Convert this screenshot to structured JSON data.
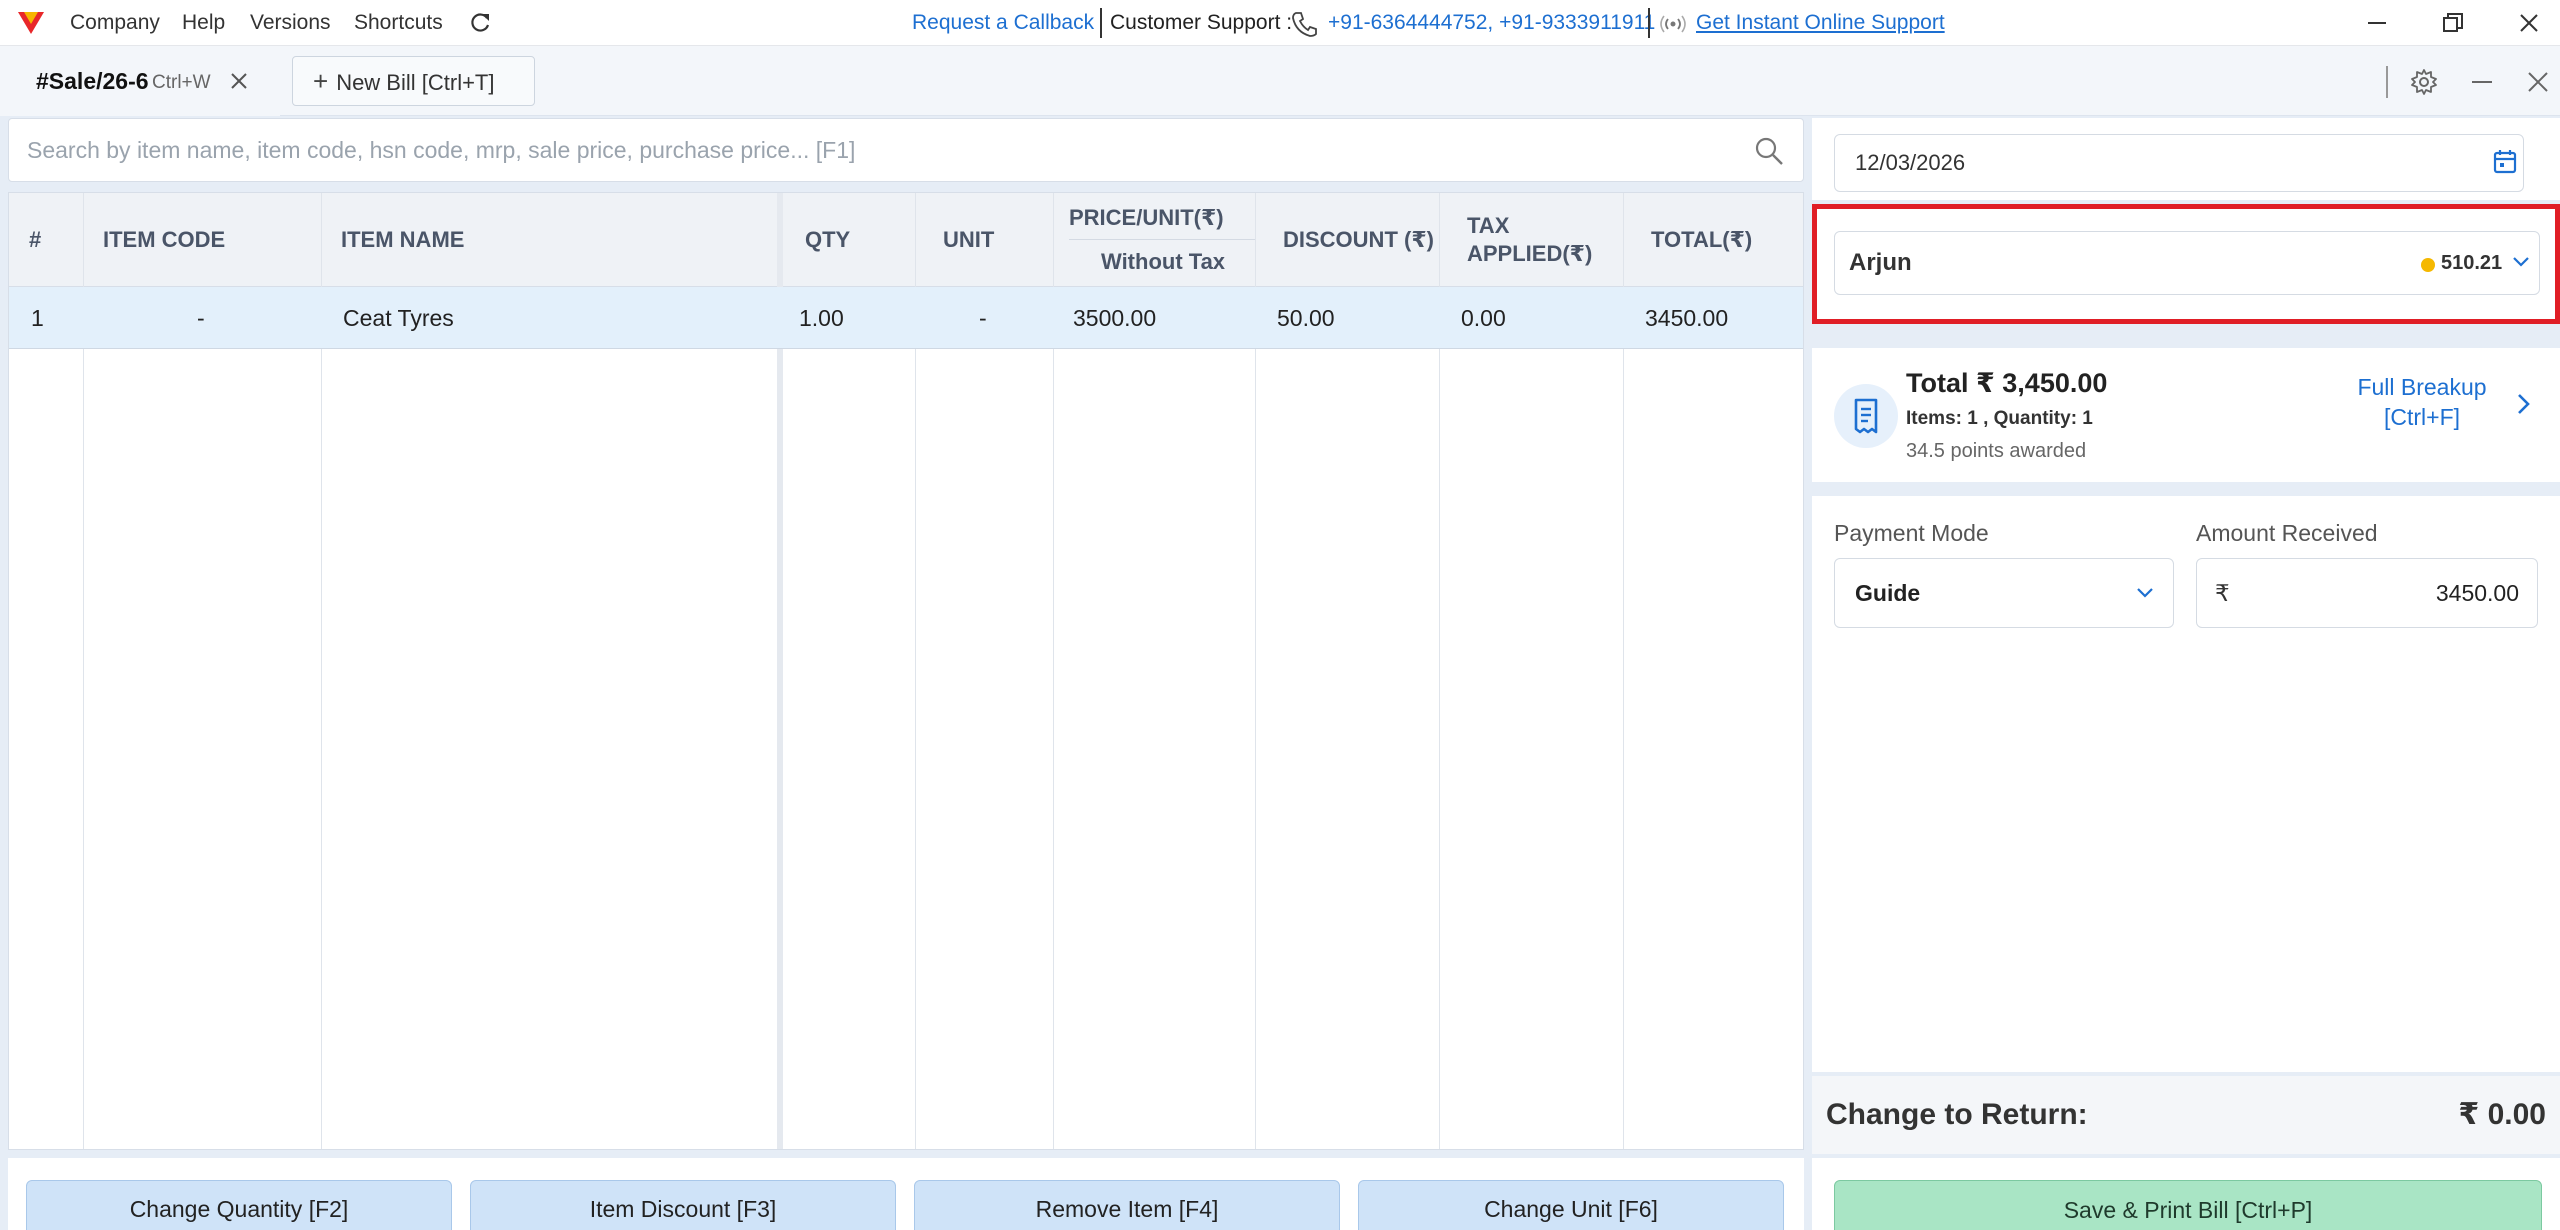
{
  "titlebar": {
    "menu": [
      "Company",
      "Help",
      "Versions",
      "Shortcuts"
    ],
    "request_callback": "Request a Callback",
    "support_label": "Customer Support :",
    "support_phones": "+91-6364444752, +91-9333911911",
    "online_support": "Get Instant Online Support"
  },
  "tabs": {
    "active_title": "#Sale/26-6",
    "active_shortcut": "Ctrl+W",
    "new_bill": "New Bill [Ctrl+T]"
  },
  "search": {
    "placeholder": "Search by item name, item code, hsn code, mrp, sale price, purchase price... [F1]"
  },
  "table": {
    "headers": {
      "index": "#",
      "item_code": "ITEM CODE",
      "item_name": "ITEM NAME",
      "qty": "QTY",
      "unit": "UNIT",
      "price": "PRICE/UNIT(₹)",
      "price_sub": "Without Tax",
      "discount": "DISCOUNT (₹)",
      "tax": "TAX APPLIED(₹)",
      "total": "TOTAL(₹)"
    },
    "rows": [
      {
        "index": "1",
        "item_code": "-",
        "item_name": "Ceat Tyres",
        "qty": "1.00",
        "unit": "-",
        "price": "3500.00",
        "discount": "50.00",
        "tax": "0.00",
        "total": "3450.00"
      }
    ]
  },
  "actions": {
    "change_qty": "Change Quantity [F2]",
    "item_discount": "Item Discount [F3]",
    "remove_item": "Remove Item [F4]",
    "change_unit": "Change Unit [F6]"
  },
  "right": {
    "date": "12/03/2026",
    "party_name": "Arjun",
    "party_points": "510.21",
    "total_title": "Total ₹ 3,450.00",
    "total_items": "Items: 1 , Quantity: 1",
    "total_points": "34.5 points awarded",
    "full_breakup": "Full Breakup [Ctrl+F]",
    "payment_mode_label": "Payment Mode",
    "payment_mode": "Guide",
    "amount_received_label": "Amount Received",
    "currency": "₹",
    "amount_received": "3450.00",
    "change_label": "Change to Return:",
    "change_value": "₹ 0.00",
    "save_print": "Save & Print Bill [Ctrl+P]"
  },
  "colors": {
    "accent": "#1d6fd1",
    "highlight_border": "#e01e26",
    "row_selected": "#e3f0fb",
    "save_button": "#a9e5c5",
    "action_button": "#cfe3f8"
  }
}
